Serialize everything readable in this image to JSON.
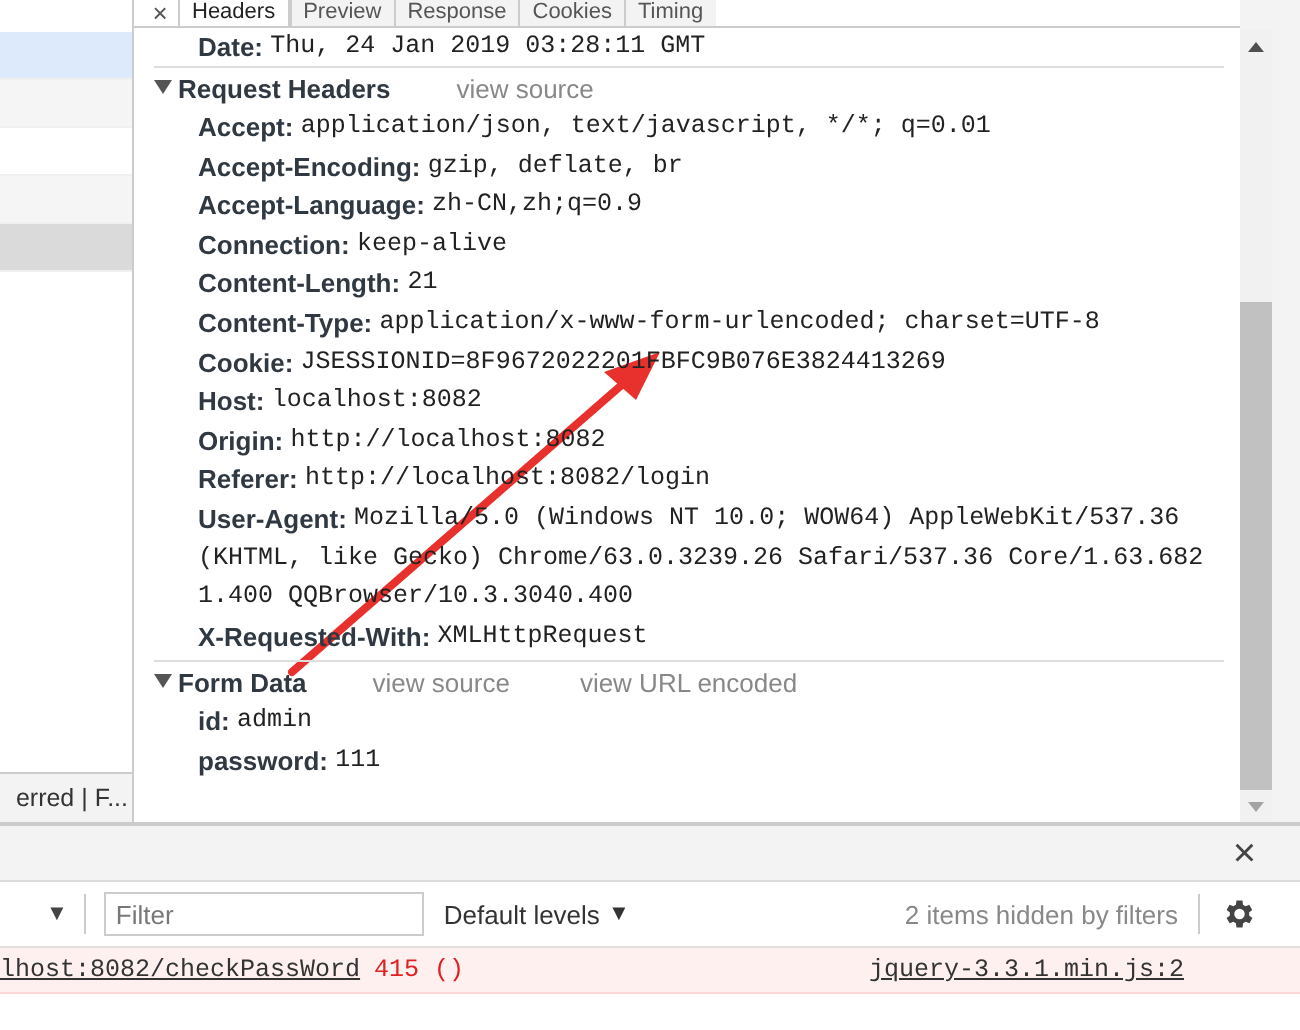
{
  "request_list": {
    "rows": [
      {
        "selected": true,
        "highlighted": false
      },
      {
        "selected": false,
        "highlighted": false
      },
      {
        "selected": false,
        "highlighted": false
      },
      {
        "selected": false,
        "highlighted": false
      },
      {
        "selected": false,
        "highlighted": true
      }
    ],
    "status_text": "erred | F..."
  },
  "details": {
    "close": "×",
    "tabs": [
      {
        "label": "Headers",
        "selected": true
      },
      {
        "label": "Preview",
        "selected": false
      },
      {
        "label": "Response",
        "selected": false
      },
      {
        "label": "Cookies",
        "selected": false
      },
      {
        "label": "Timing",
        "selected": false
      }
    ],
    "date": {
      "name": "Date:",
      "value": "Thu, 24 Jan 2019 03:28:11 GMT"
    },
    "sections": [
      {
        "title": "Request Headers",
        "expanded": true,
        "links": [
          "view source"
        ],
        "items": [
          {
            "name": "Accept:",
            "value": "application/json, text/javascript, */*; q=0.01"
          },
          {
            "name": "Accept-Encoding:",
            "value": "gzip, deflate, br"
          },
          {
            "name": "Accept-Language:",
            "value": "zh-CN,zh;q=0.9"
          },
          {
            "name": "Connection:",
            "value": "keep-alive"
          },
          {
            "name": "Content-Length:",
            "value": "21"
          },
          {
            "name": "Content-Type:",
            "value": "application/x-www-form-urlencoded; charset=UTF-8"
          },
          {
            "name": "Cookie:",
            "value": "JSESSIONID=8F9672022201FBFC9B076E3824413269"
          },
          {
            "name": "Host:",
            "value": "localhost:8082"
          },
          {
            "name": "Origin:",
            "value": "http://localhost:8082"
          },
          {
            "name": "Referer:",
            "value": "http://localhost:8082/login"
          },
          {
            "name": "User-Agent:",
            "value": "Mozilla/5.0 (Windows NT 10.0; WOW64) AppleWebKit/537.36 (KHTML, like Gecko) Chrome/63.0.3239.26 Safari/537.36 Core/1.63.6821.400 QQBrowser/10.3.3040.400"
          },
          {
            "name": "X-Requested-With:",
            "value": "XMLHttpRequest"
          }
        ]
      },
      {
        "title": "Form Data",
        "expanded": true,
        "links": [
          "view source",
          "view URL encoded"
        ],
        "items": [
          {
            "name": "id:",
            "value": "admin"
          },
          {
            "name": "password:",
            "value": "111"
          }
        ]
      }
    ]
  },
  "console": {
    "close": "×",
    "context_caret": "▼",
    "filter": {
      "placeholder": "Filter"
    },
    "levels": {
      "label": "Default levels",
      "caret": "▼"
    },
    "hidden_note": "2 items hidden by filters",
    "messages": [
      {
        "kind": "error",
        "url": "lhost:8082/checkPassWord",
        "status": "415 ()",
        "source": "jquery-3.3.1.min.js:2"
      }
    ]
  }
}
